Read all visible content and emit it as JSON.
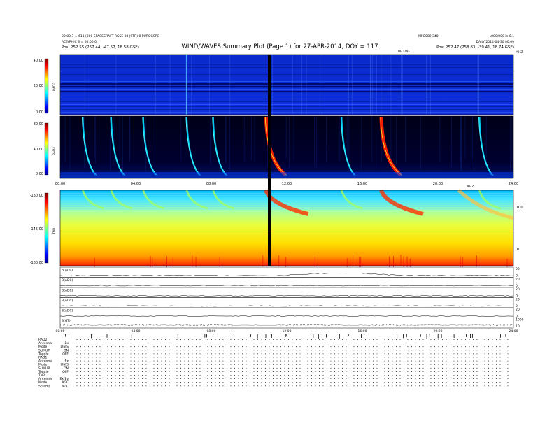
{
  "header": {
    "title": "WIND/WAVES Summary Plot (Page 1) for 27-APR-2014, DOY = 117",
    "left_line1": "00:00:3 = 611 (000 SPACECRAFT RGSE 00 (STR) 0 PUROGSPC",
    "left_line2": "ACE(PH)C 3 = 00:00:0",
    "left_line3": "Pos: 252.55 (257.44, -47.57, 18.58 GSE)",
    "right_line1": "L000/000 in 0.1",
    "right_line2": "DAILY 2014-04-30 00:09",
    "right_line3": "Pos: 252.47 (258.83, -39.41, 18.74 GSE)",
    "center_right_label": "MFO000.340",
    "mid_label": "TIE LINE",
    "rad2_corner_label": "MHZ"
  },
  "chart_data": [
    {
      "type": "heatmap",
      "name": "RAD2",
      "ylim": [
        0.0,
        40.0
      ],
      "y_ticks": [
        "40.00",
        "20.00",
        "0.00"
      ],
      "colorbar_label": "RAD2",
      "features": "quiet background with horizontal interference lines"
    },
    {
      "type": "heatmap",
      "name": "RAD1",
      "ylim": [
        0.0,
        80.0
      ],
      "y_ticks": [
        "80.00",
        "40.00",
        "0.00"
      ],
      "colorbar_label": "RAD1",
      "x_ticks": [
        "00:00",
        "04:00",
        "08:00",
        "12:00",
        "16:00",
        "20:00",
        "24:00"
      ],
      "xlim": [
        0,
        24
      ],
      "bursts_hours": [
        1.2,
        2.7,
        4.4,
        6.7,
        8.1,
        10.9,
        14.9,
        17.0,
        22.2
      ],
      "strong_burst_hours": [
        10.9,
        17.0
      ]
    },
    {
      "type": "heatmap",
      "name": "TNR",
      "ylim": [
        -160.0,
        -130.0
      ],
      "y_ticks": [
        "-130.00",
        "-145.00",
        "-160.00"
      ],
      "colorbar_label": "TNR",
      "right_ticks": [
        "100",
        "10"
      ],
      "right_label": "KHZ"
    },
    {
      "type": "line",
      "name": "magnetic field stack",
      "panels": [
        {
          "label": "B(ADC)",
          "right": [
            "20",
            "0"
          ]
        },
        {
          "label": "B(ADC)",
          "right": [
            "20",
            "0"
          ]
        },
        {
          "label": "B(ADC)",
          "right": [
            "20",
            "0"
          ]
        },
        {
          "label": "B(ADC)",
          "right": [
            "20",
            "0"
          ]
        },
        {
          "label": "B(ADC)",
          "right": [
            "20",
            "0"
          ]
        },
        {
          "label": "B(GT)",
          "right": [
            "1000",
            "10"
          ]
        }
      ],
      "x_ticks": [
        "00:00",
        "04:00",
        "08:00",
        "12:00",
        "16:00",
        "20:00",
        "24:00"
      ]
    }
  ],
  "footer": {
    "rows": [
      {
        "label": "RAD2",
        "value": ""
      },
      {
        "label": "Antenna",
        "value": "Ex"
      },
      {
        "label": "Mode",
        "value": "LIN S"
      },
      {
        "label": "SUMUP",
        "value": "ON"
      },
      {
        "label": "Toggle",
        "value": "OFF"
      },
      {
        "label": "RAD1",
        "value": ""
      },
      {
        "label": "Antenna",
        "value": "Ex"
      },
      {
        "label": "Mode",
        "value": "LIN S"
      },
      {
        "label": "SUMUP",
        "value": "ON"
      },
      {
        "label": "Toggle",
        "value": "OFF"
      },
      {
        "label": "TNR",
        "value": ""
      },
      {
        "label": "Antenna",
        "value": "Ex/Ey"
      },
      {
        "label": "Mode",
        "value": "AGC"
      },
      {
        "label": "Scramp",
        "value": "AGC"
      }
    ]
  },
  "colors": {
    "jet_dark_blue": "#00008f",
    "jet_blue": "#0000ff",
    "jet_cyan": "#00ffff",
    "jet_yellow": "#ffff00",
    "jet_red": "#ff0000"
  }
}
